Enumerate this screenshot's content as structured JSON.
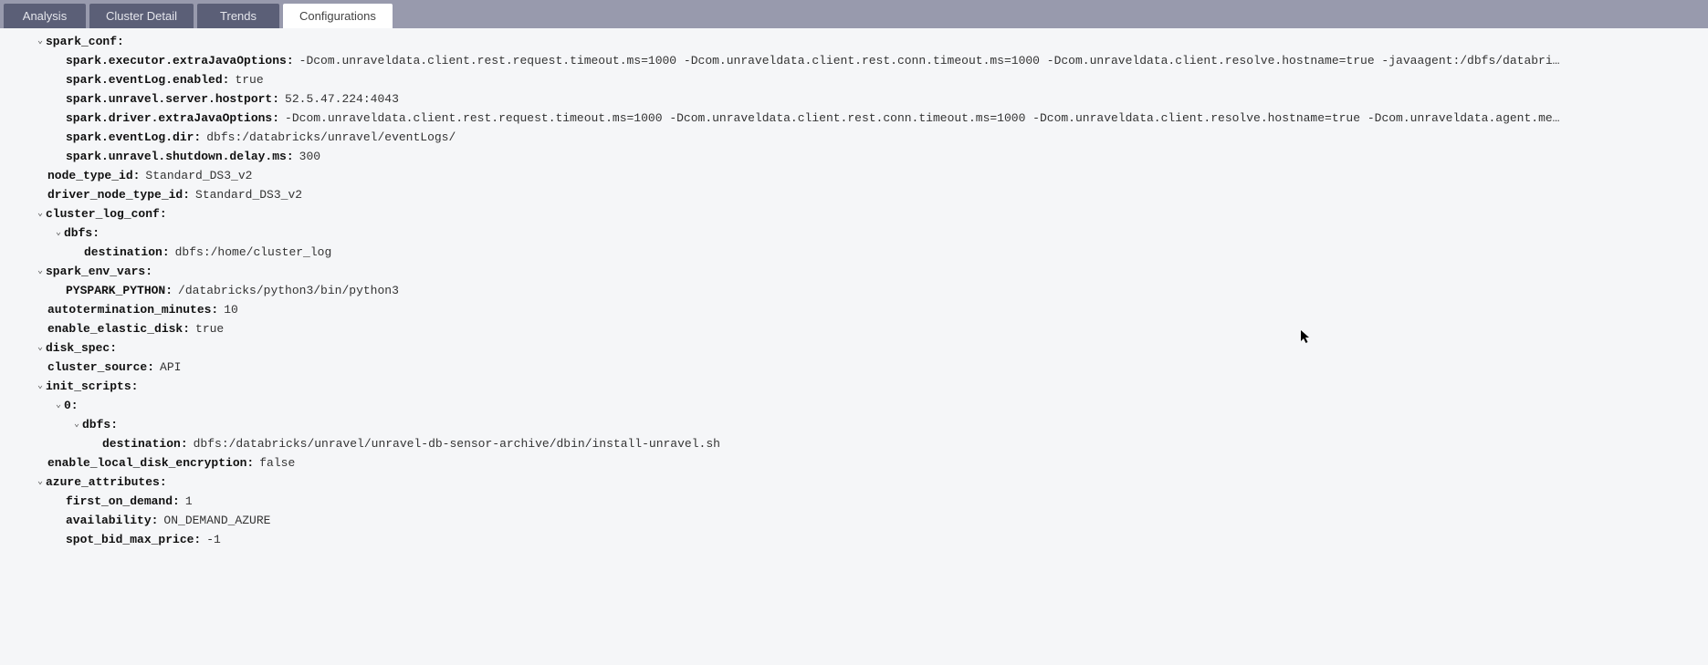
{
  "tabs": {
    "analysis": "Analysis",
    "cluster_detail": "Cluster Detail",
    "trends": "Trends",
    "configurations": "Configurations"
  },
  "tree": {
    "spark_conf": {
      "label": "spark_conf:",
      "items": {
        "execJava": {
          "k": "spark.executor.extraJavaOptions:",
          "v": "-Dcom.unraveldata.client.rest.request.timeout.ms=1000 -Dcom.unraveldata.client.rest.conn.timeout.ms=1000 -Dcom.unraveldata.client.resolve.hostname=true -javaagent:/dbfs/databri…"
        },
        "eventLogEn": {
          "k": "spark.eventLog.enabled:",
          "v": "true"
        },
        "hostport": {
          "k": "spark.unravel.server.hostport:",
          "v": "52.5.47.224:4043"
        },
        "driverJava": {
          "k": "spark.driver.extraJavaOptions:",
          "v": "-Dcom.unraveldata.client.rest.request.timeout.ms=1000 -Dcom.unraveldata.client.rest.conn.timeout.ms=1000 -Dcom.unraveldata.client.resolve.hostname=true -Dcom.unraveldata.agent.me…"
        },
        "eventLogDir": {
          "k": "spark.eventLog.dir:",
          "v": "dbfs:/databricks/unravel/eventLogs/"
        },
        "shutdown": {
          "k": "spark.unravel.shutdown.delay.ms:",
          "v": "300"
        }
      }
    },
    "node_type_id": {
      "k": "node_type_id:",
      "v": "Standard_DS3_v2"
    },
    "driver_node_type_id": {
      "k": "driver_node_type_id:",
      "v": "Standard_DS3_v2"
    },
    "cluster_log_conf": {
      "label": "cluster_log_conf:",
      "dbfs": {
        "label": "dbfs:",
        "destination": {
          "k": "destination:",
          "v": "dbfs:/home/cluster_log"
        }
      }
    },
    "spark_env_vars": {
      "label": "spark_env_vars:",
      "pyspark": {
        "k": "PYSPARK_PYTHON:",
        "v": "/databricks/python3/bin/python3"
      }
    },
    "autotermination_minutes": {
      "k": "autotermination_minutes:",
      "v": "10"
    },
    "enable_elastic_disk": {
      "k": "enable_elastic_disk:",
      "v": "true"
    },
    "disk_spec": {
      "label": "disk_spec:"
    },
    "cluster_source": {
      "k": "cluster_source:",
      "v": "API"
    },
    "init_scripts": {
      "label": "init_scripts:",
      "zero": {
        "label": "0:",
        "dbfs": {
          "label": "dbfs:",
          "destination": {
            "k": "destination:",
            "v": "dbfs:/databricks/unravel/unravel-db-sensor-archive/dbin/install-unravel.sh"
          }
        }
      }
    },
    "enable_local_disk_encryption": {
      "k": "enable_local_disk_encryption:",
      "v": "false"
    },
    "azure_attributes": {
      "label": "azure_attributes:",
      "first_on_demand": {
        "k": "first_on_demand:",
        "v": "1"
      },
      "availability": {
        "k": "availability:",
        "v": "ON_DEMAND_AZURE"
      },
      "spot_bid_max_price": {
        "k": "spot_bid_max_price:",
        "v": "-1"
      }
    }
  }
}
